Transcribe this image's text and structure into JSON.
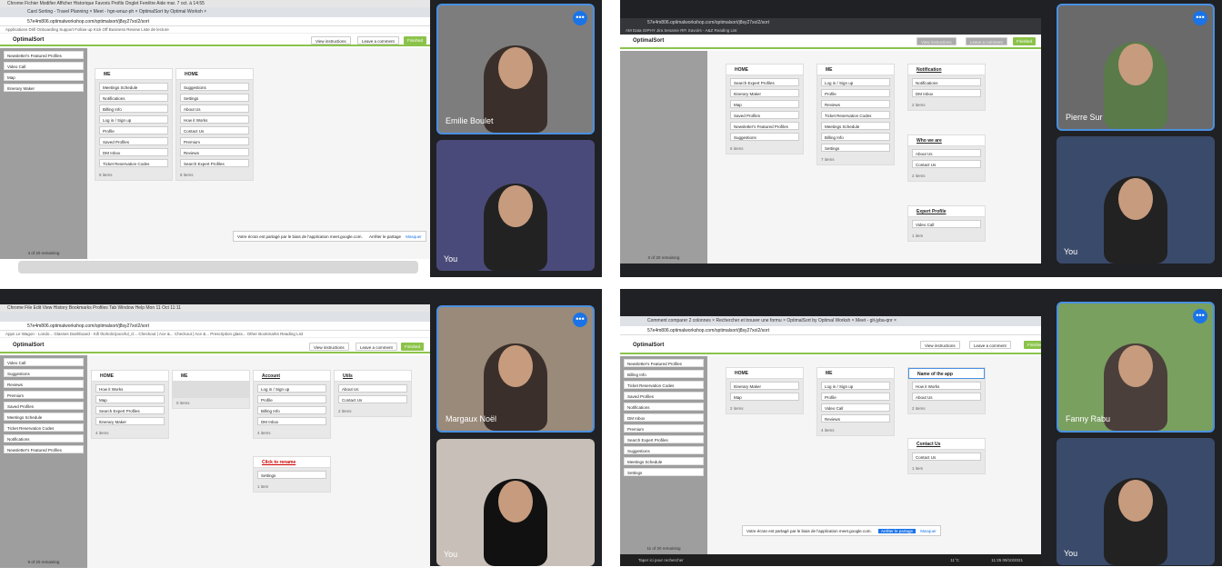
{
  "q1": {
    "mac": "Chrome   Fichier   Modifier   Afficher   Historique   Favoris   Profils   Onglet   Fenêtre   Aide            mar. 7 oct. à 14:55",
    "tabs": "Card Sorting - Travel Planning ×   Meet - hgn-wnuz-ph ×   OptimalSort by Optimal Worksh ×",
    "url": "57e4m806.optimalworkshop.com/optimalsort/j8sy27xol2/sort",
    "bm": "Applications   Drill   Onboarding   Support   Follow up   Kick Off   Business Review        Liste de lecture",
    "app": "OptimalSort",
    "view": "View instructions",
    "comment": "Leave a comment",
    "fin": "Finished",
    "side": [
      "Newsletter's Featured Profiles",
      "Video Call",
      "Map",
      "Itinerary Maker"
    ],
    "rem": "4 of 20 remaining",
    "me": {
      "t": "ME",
      "items": [
        "Meetings Schedule",
        "Notifications",
        "Billing Info",
        "Log in / Sign up",
        "Profile",
        "Saved Profiles",
        "DM Inbox",
        "Ticket Reservation Codes"
      ],
      "c": "8 items"
    },
    "home": {
      "t": "HOME",
      "items": [
        "Suggestions",
        "Settings",
        "About Us",
        "How it Works",
        "Contact Us",
        "Premium",
        "Reviews",
        "Search Expert Profiles"
      ],
      "c": "8 items"
    },
    "share": "Votre écran est partagé par le biais de l'application meet.google.com.",
    "stop": "Arrêter le partage",
    "hide": "Masquer",
    "p1": "Emilie Boulet",
    "p2": "You"
  },
  "q2": {
    "url": "57e4m806.optimalworkshop.com/optimalsort/j8sy27xol2/sort",
    "bm": "AM   Data   GIPHY   Jira   Sesame   RFI Savoirs - A&Z      Reading List",
    "app": "OptimalSort",
    "view": "View instructions",
    "comment": "Leave a comment",
    "fin": "Finished",
    "rem": "0 of 20 remaining",
    "home": {
      "t": "HOME",
      "items": [
        "Search Expert Profiles",
        "Itinerary Maker",
        "Map",
        "Saved Profiles",
        "Newsletter's Featured Profiles",
        "Suggestions"
      ],
      "c": "6 items"
    },
    "me": {
      "t": "ME",
      "items": [
        "Log in / Sign up",
        "Profile",
        "Reviews",
        "Ticket Reservation Codes",
        "Meetings Schedule",
        "Billing Info",
        "Settings"
      ],
      "c": "7 items"
    },
    "g3": {
      "t": "Notification",
      "items": [
        "Notifications",
        "DM Inbox"
      ],
      "c": "2 items"
    },
    "g4": {
      "t": "Who we are",
      "items": [
        "About Us",
        "Contact Us"
      ],
      "c": "2 items"
    },
    "g5": {
      "t": "Expert Profile",
      "items": [
        "Video Call"
      ],
      "c": "1 item"
    },
    "p1": "Pierre Sur",
    "p2": "You"
  },
  "q3": {
    "mac": "Chrome   File   Edit   View   History   Bookmarks   Profiles   Tab   Window   Help                                        Mon 11 Oct  11:11",
    "url": "57e4m806.optimalworkshop.com/optimalsort/j8sy27xol2/sort",
    "bm": "Apps   Le Wagon - Londo...   Glasses   Dashboard - Kifi   thoholic/poceful_cl...   Checkout | Ace &...   Checkout | Ace &...   Prescription glass...      Other Bookmarks   Reading List",
    "app": "OptimalSort",
    "view": "View instructions",
    "comment": "Leave a comment",
    "fin": "Finished",
    "side": [
      "Video Call",
      "Suggestions",
      "Reviews",
      "Premium",
      "Saved Profiles",
      "Meetings Schedule",
      "Ticket Reservation Codes",
      "Notifications",
      "Newsletter's Featured Profiles"
    ],
    "rem": "9 of 20 remaining",
    "home": {
      "t": "HOME",
      "items": [
        "How it Works",
        "Map",
        "Search Expert Profiles",
        "Itinerary Maker"
      ],
      "c": "4 items"
    },
    "me": {
      "t": "ME",
      "items": [],
      "c": "0 items"
    },
    "acc": {
      "t": "Account",
      "items": [
        "Log in / Sign up",
        "Profile",
        "Billing Info",
        "DM Inbox"
      ],
      "c": "4 items"
    },
    "utils": {
      "t": "Utils",
      "items": [
        "About Us",
        "Contact Us"
      ],
      "c": "2 items"
    },
    "ren": {
      "t": "Click to rename",
      "items": [
        "Settings"
      ],
      "c": "1 item"
    },
    "p1": "Margaux Noël",
    "p2": "You"
  },
  "q4": {
    "tabs": "Comment comparer 2 colonnes ×   Rechercher et trouver une formu ×   OptimalSort by Optimal Worksh ×   Meet - git-jyba-qnr ×",
    "url": "57e4m806.optimalworkshop.com/optimalsort/j8sy27xol2/sort",
    "app": "OptimalSort",
    "view": "View instructions",
    "comment": "Leave a comment",
    "fin": "Finished",
    "side": [
      "Newsletter's Featured Profiles",
      "Billing Info",
      "Ticket Reservation Codes",
      "Saved Profiles",
      "Notifications",
      "DM Inbox",
      "Premium",
      "Search Expert Profiles",
      "Suggestions",
      "Meetings Schedule",
      "Settings"
    ],
    "rem": "11 of 20 remaining",
    "home": {
      "t": "HOME",
      "items": [
        "Itinerary Maker",
        "Map"
      ],
      "c": "2 items"
    },
    "me": {
      "t": "ME",
      "items": [
        "Log in / Sign up",
        "Profile",
        "Video Call",
        "Reviews"
      ],
      "c": "4 items"
    },
    "app2": {
      "t": "Name of the app",
      "items": [
        "How it Works",
        "About Us"
      ],
      "c": "2 items"
    },
    "cu": {
      "t": "Contact Us",
      "items": [
        "Contact Us"
      ],
      "c": "1 item"
    },
    "share": "Votre écran est partagé par le biais de l'application meet.google.com.",
    "stop": "Arrêter le partage",
    "hide": "Masquer",
    "search": "Taper ici pour rechercher",
    "clock": "11:25  09/10/2021",
    "temp": "11°C",
    "p1": "Fanny Rabu",
    "p2": "You"
  }
}
